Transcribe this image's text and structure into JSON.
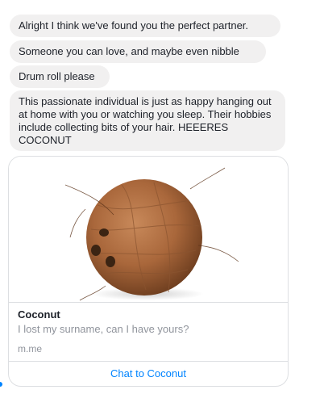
{
  "messages": [
    {
      "text": "Alright I think we've found you the perfect partner."
    },
    {
      "text": "Someone you can love, and maybe even nibble"
    },
    {
      "text": "Drum roll please"
    },
    {
      "text": "This passionate individual is just as happy hanging out at home with you or watching you sleep. Their hobbies include collecting bits of your hair. HEEERES COCONUT"
    }
  ],
  "card": {
    "image_icon": "coconut-photo",
    "title": "Coconut",
    "subtitle": "I lost my surname, can I have yours?",
    "domain": "m.me",
    "button_label": "Chat to Coconut"
  },
  "colors": {
    "bubble_bg": "#f1f0f0",
    "text": "#1d2129",
    "muted": "#90949c",
    "accent": "#0084ff",
    "border": "#dddfe2"
  }
}
